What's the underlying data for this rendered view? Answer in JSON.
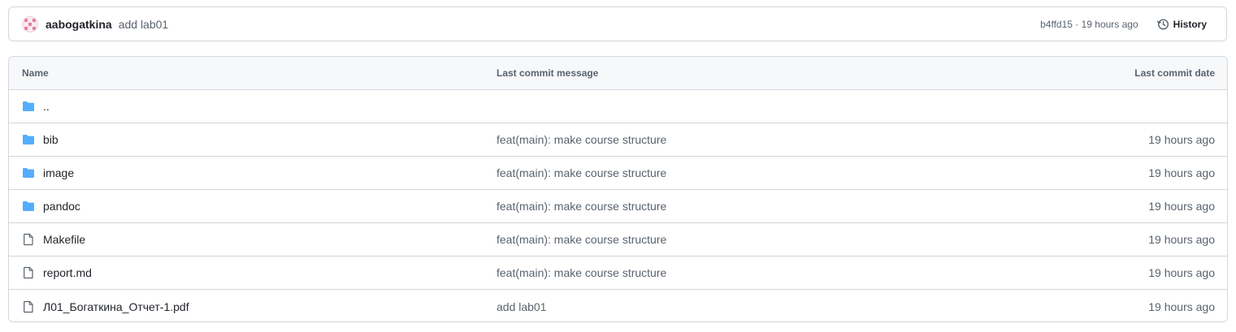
{
  "commit": {
    "author": "aabogatkina",
    "message": "add lab01",
    "sha_time": "b4ffd15 · 19 hours ago",
    "history_label": "History"
  },
  "table": {
    "headers": {
      "name": "Name",
      "message": "Last commit message",
      "date": "Last commit date"
    },
    "rows": [
      {
        "type": "folder",
        "name": "..",
        "message": "",
        "date": ""
      },
      {
        "type": "folder",
        "name": "bib",
        "message": "feat(main): make course structure",
        "date": "19 hours ago"
      },
      {
        "type": "folder",
        "name": "image",
        "message": "feat(main): make course structure",
        "date": "19 hours ago"
      },
      {
        "type": "folder",
        "name": "pandoc",
        "message": "feat(main): make course structure",
        "date": "19 hours ago"
      },
      {
        "type": "file",
        "name": "Makefile",
        "message": "feat(main): make course structure",
        "date": "19 hours ago"
      },
      {
        "type": "file",
        "name": "report.md",
        "message": "feat(main): make course structure",
        "date": "19 hours ago"
      },
      {
        "type": "file",
        "name": "Л01_Богаткина_Отчет-1.pdf",
        "message": "add lab01",
        "date": "19 hours ago"
      }
    ]
  },
  "colors": {
    "folder": "#54aeff",
    "file": "#59636e",
    "border": "#d0d7de",
    "header_bg": "#f6f8fa"
  }
}
